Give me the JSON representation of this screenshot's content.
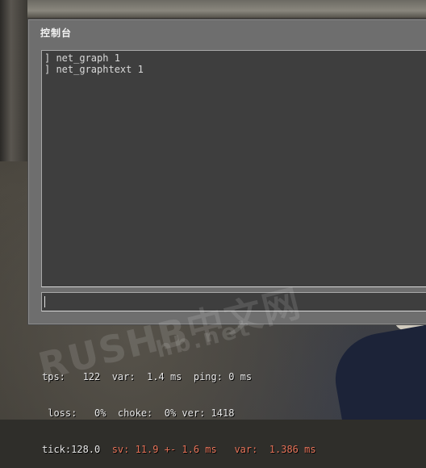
{
  "console": {
    "title": "控制台",
    "lines": [
      "] net_graph 1",
      "] net_graphtext 1"
    ],
    "input_value": ""
  },
  "watermark": {
    "logo": "RUSHB中文网",
    "url": "www.rushb.net",
    "logo_repeat": "RUSHB中文网",
    "url_partial": "hb.net"
  },
  "net_graph": {
    "row1": "tps:   122  var:  1.4 ms  ping: 0 ms",
    "row2": " loss:   0%  choke:  0% ver: 1418",
    "row3_prefix": "tick:128.0  ",
    "row3_sv": "sv: 11.9 +- 1.6 ms",
    "row3_gap": "   ",
    "row3_var": "var:  1.386 ms",
    "colors": {
      "normal": "#e8e8e8",
      "warning": "#e8745a"
    }
  }
}
